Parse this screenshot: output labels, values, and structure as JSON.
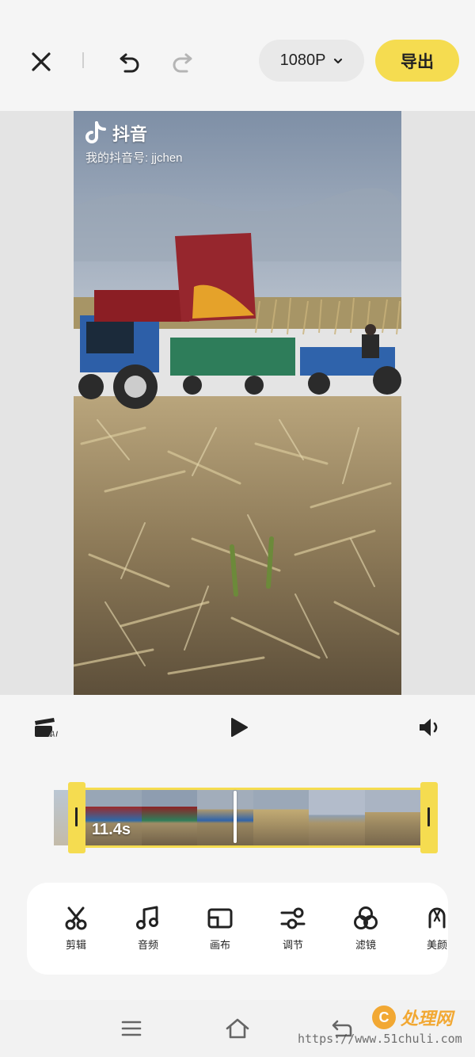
{
  "topbar": {
    "resolution": "1080P",
    "export_label": "导出"
  },
  "video": {
    "app_name": "抖音",
    "account_text": "我的抖音号: jjchen"
  },
  "timeline": {
    "duration": "11.4s"
  },
  "toolbar": {
    "items": [
      {
        "label": "剪辑",
        "icon": "scissors-icon"
      },
      {
        "label": "音频",
        "icon": "music-note-icon"
      },
      {
        "label": "画布",
        "icon": "canvas-icon"
      },
      {
        "label": "调节",
        "icon": "adjust-sliders-icon"
      },
      {
        "label": "滤镜",
        "icon": "filter-circles-icon"
      },
      {
        "label": "美颜",
        "icon": "beauty-icon"
      }
    ]
  },
  "watermark": {
    "url": "https://www.51chuli.com",
    "brand": "处理网",
    "logo_letter": "C"
  },
  "colors": {
    "accent": "#f5dc50",
    "background": "#f5f5f5"
  }
}
